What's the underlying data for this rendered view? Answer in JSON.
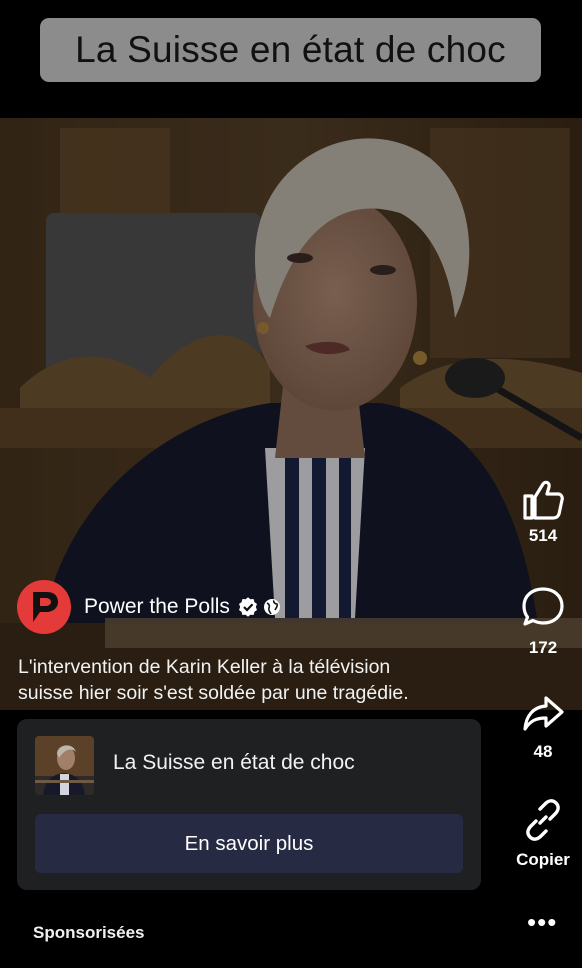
{
  "overlay_title": "La Suisse en état de choc",
  "post": {
    "author": "Power the Polls",
    "caption_line1": "L'intervention de Karin Keller à la télévision",
    "caption_line2": "suisse hier soir s'est soldée par une tragédie."
  },
  "actions": {
    "like_count": "514",
    "comment_count": "172",
    "share_count": "48",
    "copy_label": "Copier"
  },
  "ad_card": {
    "title": "La Suisse en état de choc",
    "cta_label": "En savoir plus"
  },
  "footer": {
    "sponsored_label": "Sponsorisées",
    "more_label": "•••"
  },
  "colors": {
    "brand_red": "#e53a3a",
    "cta_bg": "#262b43",
    "card_bg": "#1f2022"
  },
  "icons": [
    "thumbs-up-icon",
    "comment-icon",
    "share-icon",
    "link-icon",
    "verified-icon",
    "globe-icon",
    "more-icon"
  ]
}
